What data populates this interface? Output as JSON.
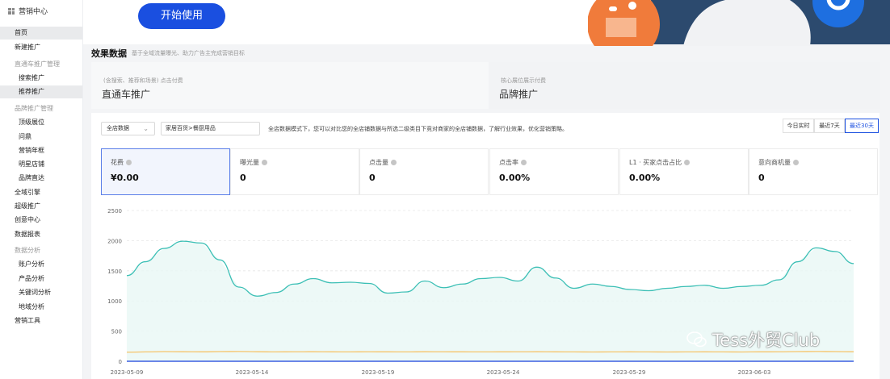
{
  "sidebar": {
    "header": "营销中心",
    "items": [
      {
        "label": "首页",
        "kind": "item",
        "active": true
      },
      {
        "label": "新建推广",
        "kind": "item"
      },
      {
        "label": "直通车推广管理",
        "kind": "group"
      },
      {
        "label": "搜索推广",
        "kind": "sub"
      },
      {
        "label": "推荐推广",
        "kind": "sub",
        "active": true
      },
      {
        "label": "品牌推广管理",
        "kind": "group"
      },
      {
        "label": "顶级展位",
        "kind": "sub"
      },
      {
        "label": "问鼎",
        "kind": "sub"
      },
      {
        "label": "营销年框",
        "kind": "sub"
      },
      {
        "label": "明星店铺",
        "kind": "sub"
      },
      {
        "label": "品牌直达",
        "kind": "sub"
      },
      {
        "label": "全域引擎",
        "kind": "item"
      },
      {
        "label": "超级推广",
        "kind": "item"
      },
      {
        "label": "创意中心",
        "kind": "item"
      },
      {
        "label": "数据报表",
        "kind": "item"
      },
      {
        "label": "数据分析",
        "kind": "group"
      },
      {
        "label": "账户分析",
        "kind": "sub"
      },
      {
        "label": "产品分析",
        "kind": "sub"
      },
      {
        "label": "关键词分析",
        "kind": "sub"
      },
      {
        "label": "地域分析",
        "kind": "sub"
      },
      {
        "label": "营销工具",
        "kind": "item"
      }
    ]
  },
  "banner": {
    "start_button": "开始使用"
  },
  "effect": {
    "title": "效果数据",
    "desc": "基于全域流量曝光、助力广告主完成营销目标"
  },
  "products": [
    {
      "sub": "(含搜索、推荐和场景) 点击付费",
      "name": "直通车推广"
    },
    {
      "sub": "核心展位展示付费",
      "name": "品牌推广"
    }
  ],
  "filters": {
    "scope": "全店数据",
    "category": "家居百货>餐厨用品",
    "notice": "全店数据模式下，您可以对比您的全店铺数据与所选二级类目下竞对商家的全店铺数据，了解行业效果，优化营销策略。",
    "ranges": [
      "今日实时",
      "最近7天",
      "最近30天"
    ]
  },
  "metrics": [
    {
      "label": "花费",
      "value": "¥0.00"
    },
    {
      "label": "曝光量",
      "value": "0"
    },
    {
      "label": "点击量",
      "value": "0"
    },
    {
      "label": "点击率",
      "value": "0.00%"
    },
    {
      "label": "L1 · 买家点击占比",
      "value": "0.00%"
    },
    {
      "label": "意向商机量",
      "value": "0"
    }
  ],
  "watermark": "Tess外贸Club",
  "chart_data": {
    "type": "area",
    "yticks": [
      "2500",
      "2000",
      "1500",
      "1000",
      "500",
      "0"
    ],
    "ylim": [
      0,
      2500
    ],
    "x_labels": [
      "2023-05-09",
      "2023-05-14",
      "2023-05-19",
      "2023-05-24",
      "2023-05-29",
      "2023-06-03"
    ],
    "series": [
      {
        "color": "#3bbfb5",
        "values": [
          1420,
          1650,
          1870,
          1990,
          1960,
          1680,
          1230,
          1080,
          1140,
          1280,
          1370,
          1300,
          1310,
          1290,
          1130,
          1150,
          1330,
          1220,
          1280,
          1370,
          1390,
          1330,
          1560,
          1380,
          1210,
          1280,
          1240,
          1190,
          1170,
          1210,
          1240,
          1260,
          1210,
          1240,
          1260,
          1350,
          1650,
          1880,
          1820,
          1620
        ]
      },
      {
        "color": "#f6c46a",
        "values": [
          150,
          155,
          160,
          158,
          156,
          160,
          162,
          158,
          155,
          157,
          158,
          156,
          155,
          157,
          156,
          155,
          158,
          157,
          156,
          155,
          156,
          157,
          158,
          156,
          155,
          154,
          155,
          156,
          155,
          154,
          155,
          156,
          155,
          154,
          156,
          157,
          160,
          162,
          160,
          158
        ]
      },
      {
        "color": "#3a5fe0",
        "values": [
          0,
          0,
          0,
          0,
          0,
          0,
          0,
          0,
          0,
          0,
          0,
          0,
          0,
          0,
          0,
          0,
          0,
          0,
          0,
          0,
          0,
          0,
          0,
          0,
          0,
          0,
          0,
          0,
          0,
          0,
          0,
          0,
          0,
          0,
          0,
          0,
          0,
          0,
          0,
          0
        ]
      }
    ]
  }
}
